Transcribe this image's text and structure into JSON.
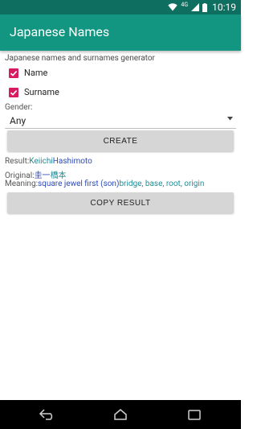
{
  "status_bar": {
    "signal_type": "4G",
    "time": "10:19"
  },
  "app_bar": {
    "title": "Japanese Names"
  },
  "main": {
    "subtitle": "Japanese names and surnames generator",
    "checkbox_name": {
      "label": "Name",
      "checked": true
    },
    "checkbox_surname": {
      "label": "Surname",
      "checked": true
    },
    "gender_label": "Gender:",
    "gender_value": "Any",
    "create_button": "CREATE",
    "result_label": "Result:",
    "result_first": "Keiichi",
    "result_last": "Hashimoto",
    "original_label": "Original:",
    "original_first": "圭一",
    "original_last": "橋本",
    "meaning_label": "Meaning:",
    "meaning_first": "square jewel first (son)",
    "meaning_last": "bridge, base, root, origin",
    "copy_button": "COPY RESULT"
  },
  "colors": {
    "primary": "#129681",
    "primary_dark": "#0e6e60",
    "accent": "#d81b60",
    "link_blue": "#2d4bb8",
    "link_teal": "#1f8c96"
  },
  "icons": [
    "wifi-icon",
    "signal-icon",
    "battery-icon",
    "check-icon",
    "dropdown-arrow-icon",
    "back-icon",
    "home-icon",
    "recents-icon"
  ]
}
